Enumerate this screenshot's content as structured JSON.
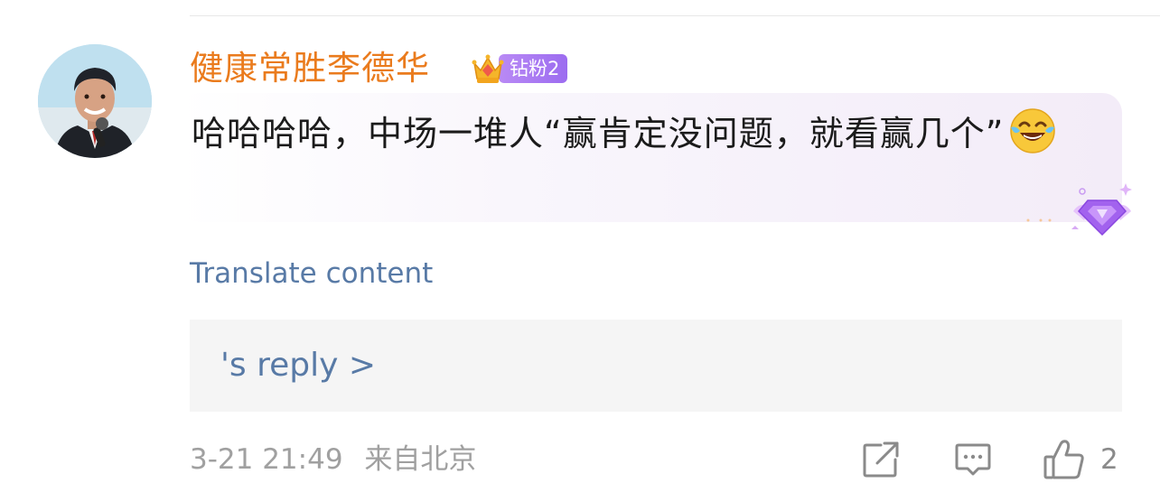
{
  "comment": {
    "username": "健康常胜李德华",
    "badge_label": "钻粉2",
    "badge_icon": "crown-icon",
    "text": "哈哈哈哈，中场一堆人“赢肯定没问题，就看赢几个”",
    "emoji": "laughing-tears-emoji",
    "translate_label": "Translate content",
    "reply_label": "'s reply >",
    "timestamp": "3-21 21:49",
    "location": "来自北京",
    "like_count": "2"
  },
  "actions": [
    {
      "name": "share",
      "icon": "share-icon"
    },
    {
      "name": "comment",
      "icon": "comment-icon"
    },
    {
      "name": "like",
      "icon": "thumbs-up-icon"
    }
  ],
  "colors": {
    "username": "#ea7b1d",
    "link": "#587aa6",
    "badge": "#a97bf3",
    "meta": "#a0a0a0"
  }
}
